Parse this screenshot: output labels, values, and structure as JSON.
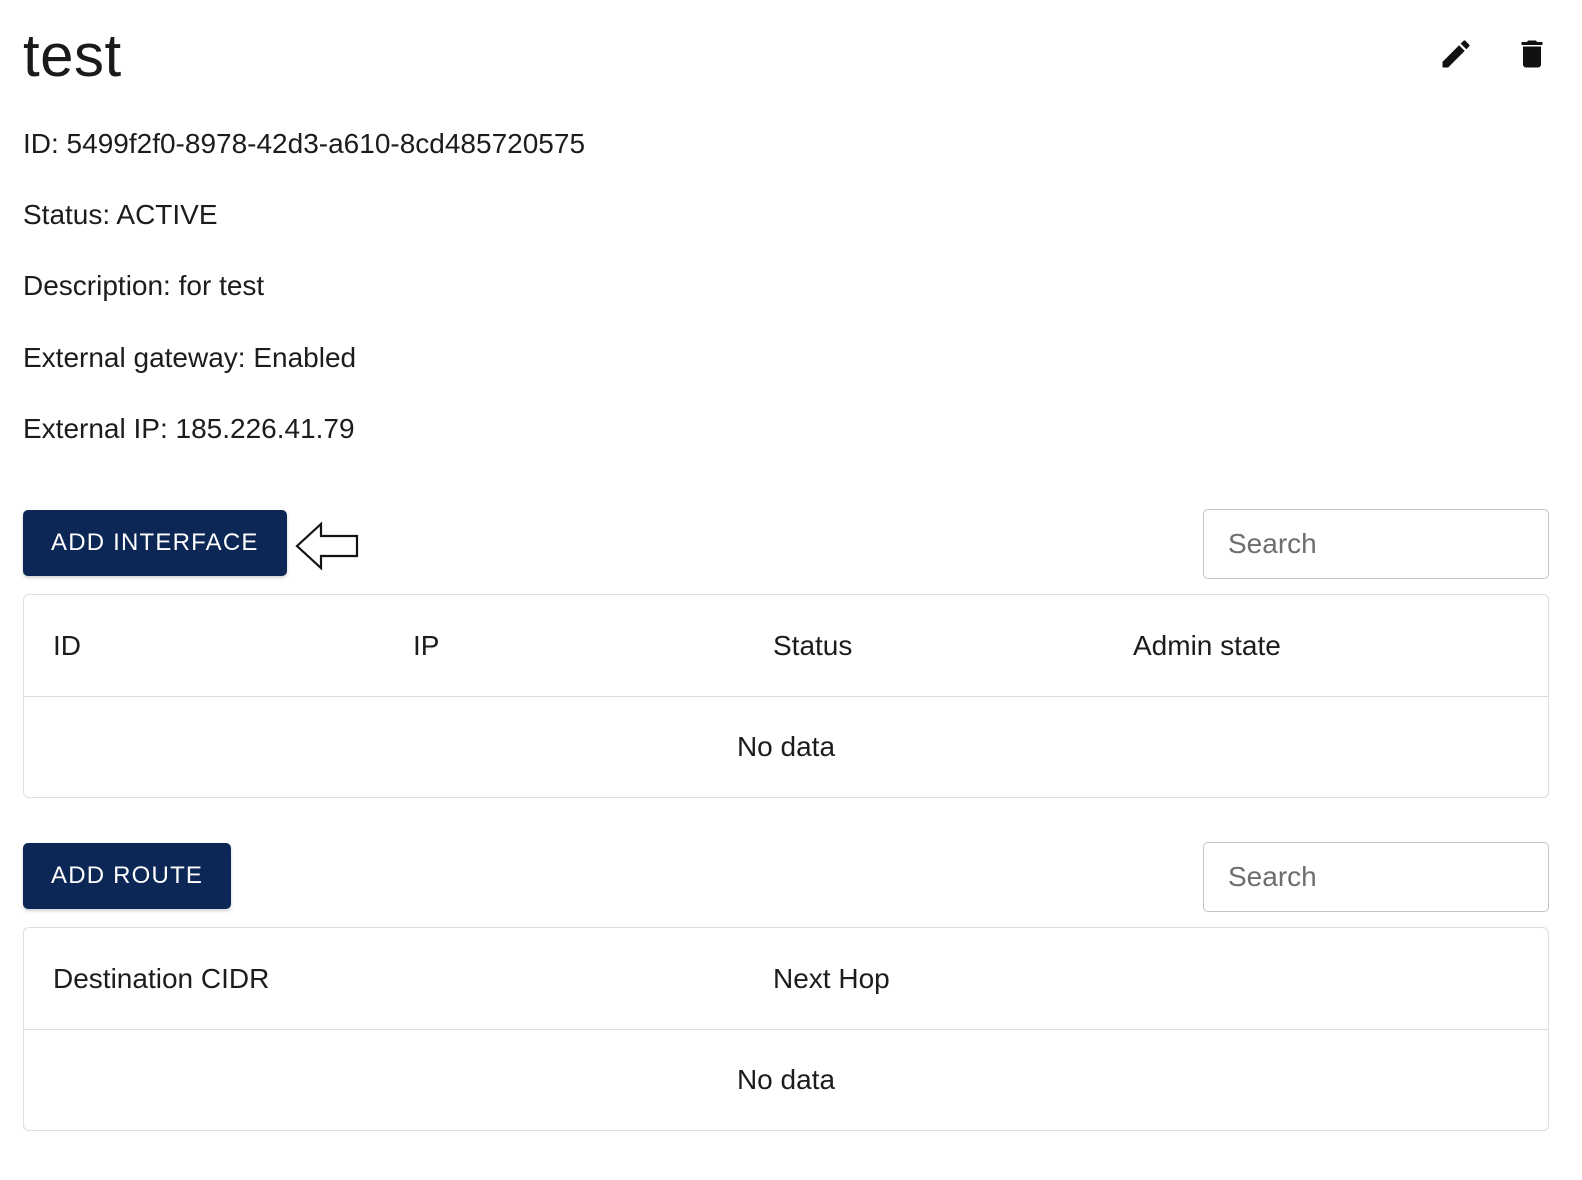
{
  "router": {
    "title": "test",
    "details": [
      "ID: 5499f2f0-8978-42d3-a610-8cd485720575",
      "Status: ACTIVE",
      "Description: for test",
      "External gateway: Enabled",
      "External IP: 185.226.41.79"
    ]
  },
  "icons": {
    "edit": "pencil-icon",
    "delete": "trash-icon",
    "hint": "left-arrow-icon"
  },
  "interfaces": {
    "add_label": "ADD INTERFACE",
    "search_placeholder": "Search",
    "columns": [
      "ID",
      "IP",
      "Status",
      "Admin state"
    ],
    "empty_text": "No data"
  },
  "routes": {
    "add_label": "ADD ROUTE",
    "search_placeholder": "Search",
    "columns": [
      "Destination CIDR",
      "Next Hop"
    ],
    "empty_text": "No data"
  },
  "colors": {
    "primary_button": "#0c2756",
    "border": "#dedede"
  }
}
